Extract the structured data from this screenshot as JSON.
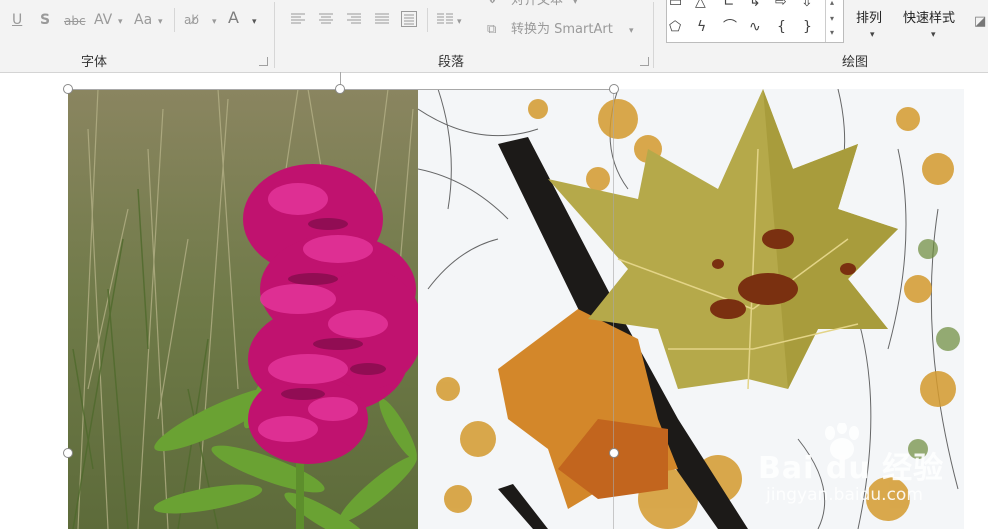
{
  "ribbon": {
    "font_group": {
      "label": "字体",
      "text_effects_glyph": "abc",
      "spacing_glyph": "AV",
      "case_glyph": "Aa",
      "font_color_glyph": "A"
    },
    "paragraph_group": {
      "label": "段落",
      "align_text_label": "对齐文本",
      "smartart_label": "转换为 SmartArt"
    },
    "drawing_group": {
      "label": "绘图",
      "arrange_label": "排列",
      "quick_styles_label": "快速样式"
    }
  },
  "watermark": {
    "brand": "Bai du 经验",
    "url": "jingyan.baidu.com"
  },
  "colors": {
    "ribbon_bg": "#f3f3f3",
    "icon_gray": "#9a9a9a",
    "handle_border": "#8a8a8a"
  }
}
